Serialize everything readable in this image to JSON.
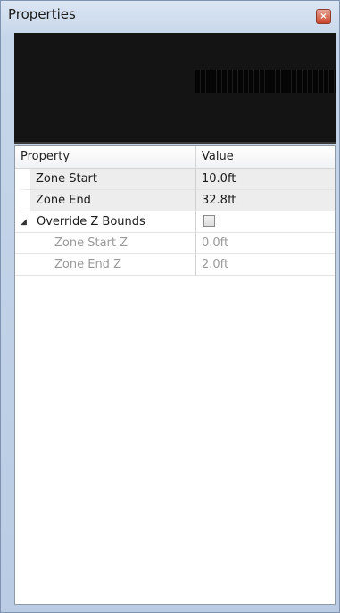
{
  "window": {
    "title": "Properties",
    "close_glyph": "×"
  },
  "grid": {
    "header": {
      "property": "Property",
      "value": "Value"
    },
    "rows": [
      {
        "label": "Zone Start",
        "value": "10.0ft"
      },
      {
        "label": "Zone End",
        "value": "32.8ft"
      },
      {
        "label": "Override Z Bounds",
        "expander_glyph": "◢",
        "checked": false
      },
      {
        "label": "Zone Start Z",
        "value": "0.0ft"
      },
      {
        "label": "Zone End Z",
        "value": "2.0ft"
      }
    ]
  }
}
